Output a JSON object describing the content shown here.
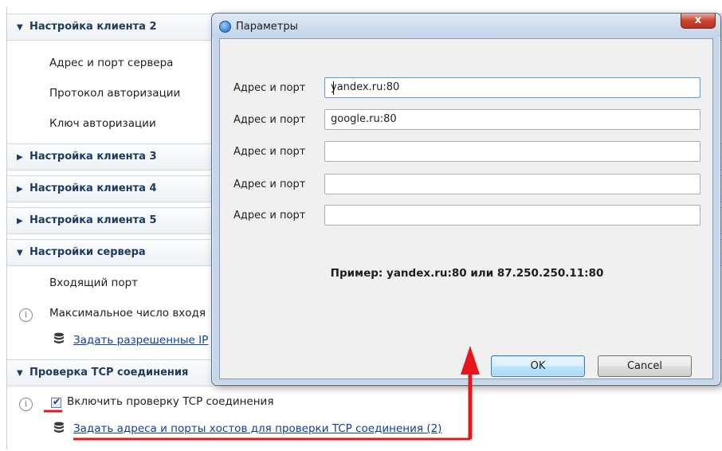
{
  "settings": {
    "client2": {
      "header": "Настройка клиента 2",
      "items": [
        "Адрес и порт сервера",
        "Протокол авторизации",
        "Ключ авторизации"
      ]
    },
    "client3": {
      "header": "Настройка клиента 3"
    },
    "client4": {
      "header": "Настройка клиента 4"
    },
    "client5": {
      "header": "Настройка клиента 5"
    },
    "server": {
      "header": "Настройки сервера",
      "incoming_port": "Входящий порт",
      "max_incoming": "Максимальное число входя",
      "allowed_ip_link": "Задать разрешенные IP"
    },
    "tcp": {
      "header": "Проверка TCP соединения",
      "enable_label": "Включить проверку TCP соединения",
      "enable_checked": true,
      "hosts_link": "Задать адреса и порты хостов для проверки TCP соединения (2)"
    }
  },
  "dialog": {
    "title": "Параметры",
    "close_symbol": "x",
    "fields": [
      {
        "label": "Адрес и порт",
        "value": "yandex.ru:80"
      },
      {
        "label": "Адрес и порт",
        "value": "google.ru:80"
      },
      {
        "label": "Адрес и порт",
        "value": ""
      },
      {
        "label": "Адрес и порт",
        "value": ""
      },
      {
        "label": "Адрес и порт",
        "value": ""
      }
    ],
    "example": "Пример: yandex.ru:80 или 87.250.250.11:80",
    "ok_label": "OK",
    "cancel_label": "Cancel"
  },
  "icons": {
    "info": "i",
    "expanded": "▼",
    "collapsed": "▶"
  },
  "colors": {
    "section_text": "#1c3b60",
    "link": "#0b3fa6",
    "annotation": "#e8141c",
    "dialog_frame": "#c7d7eb"
  }
}
